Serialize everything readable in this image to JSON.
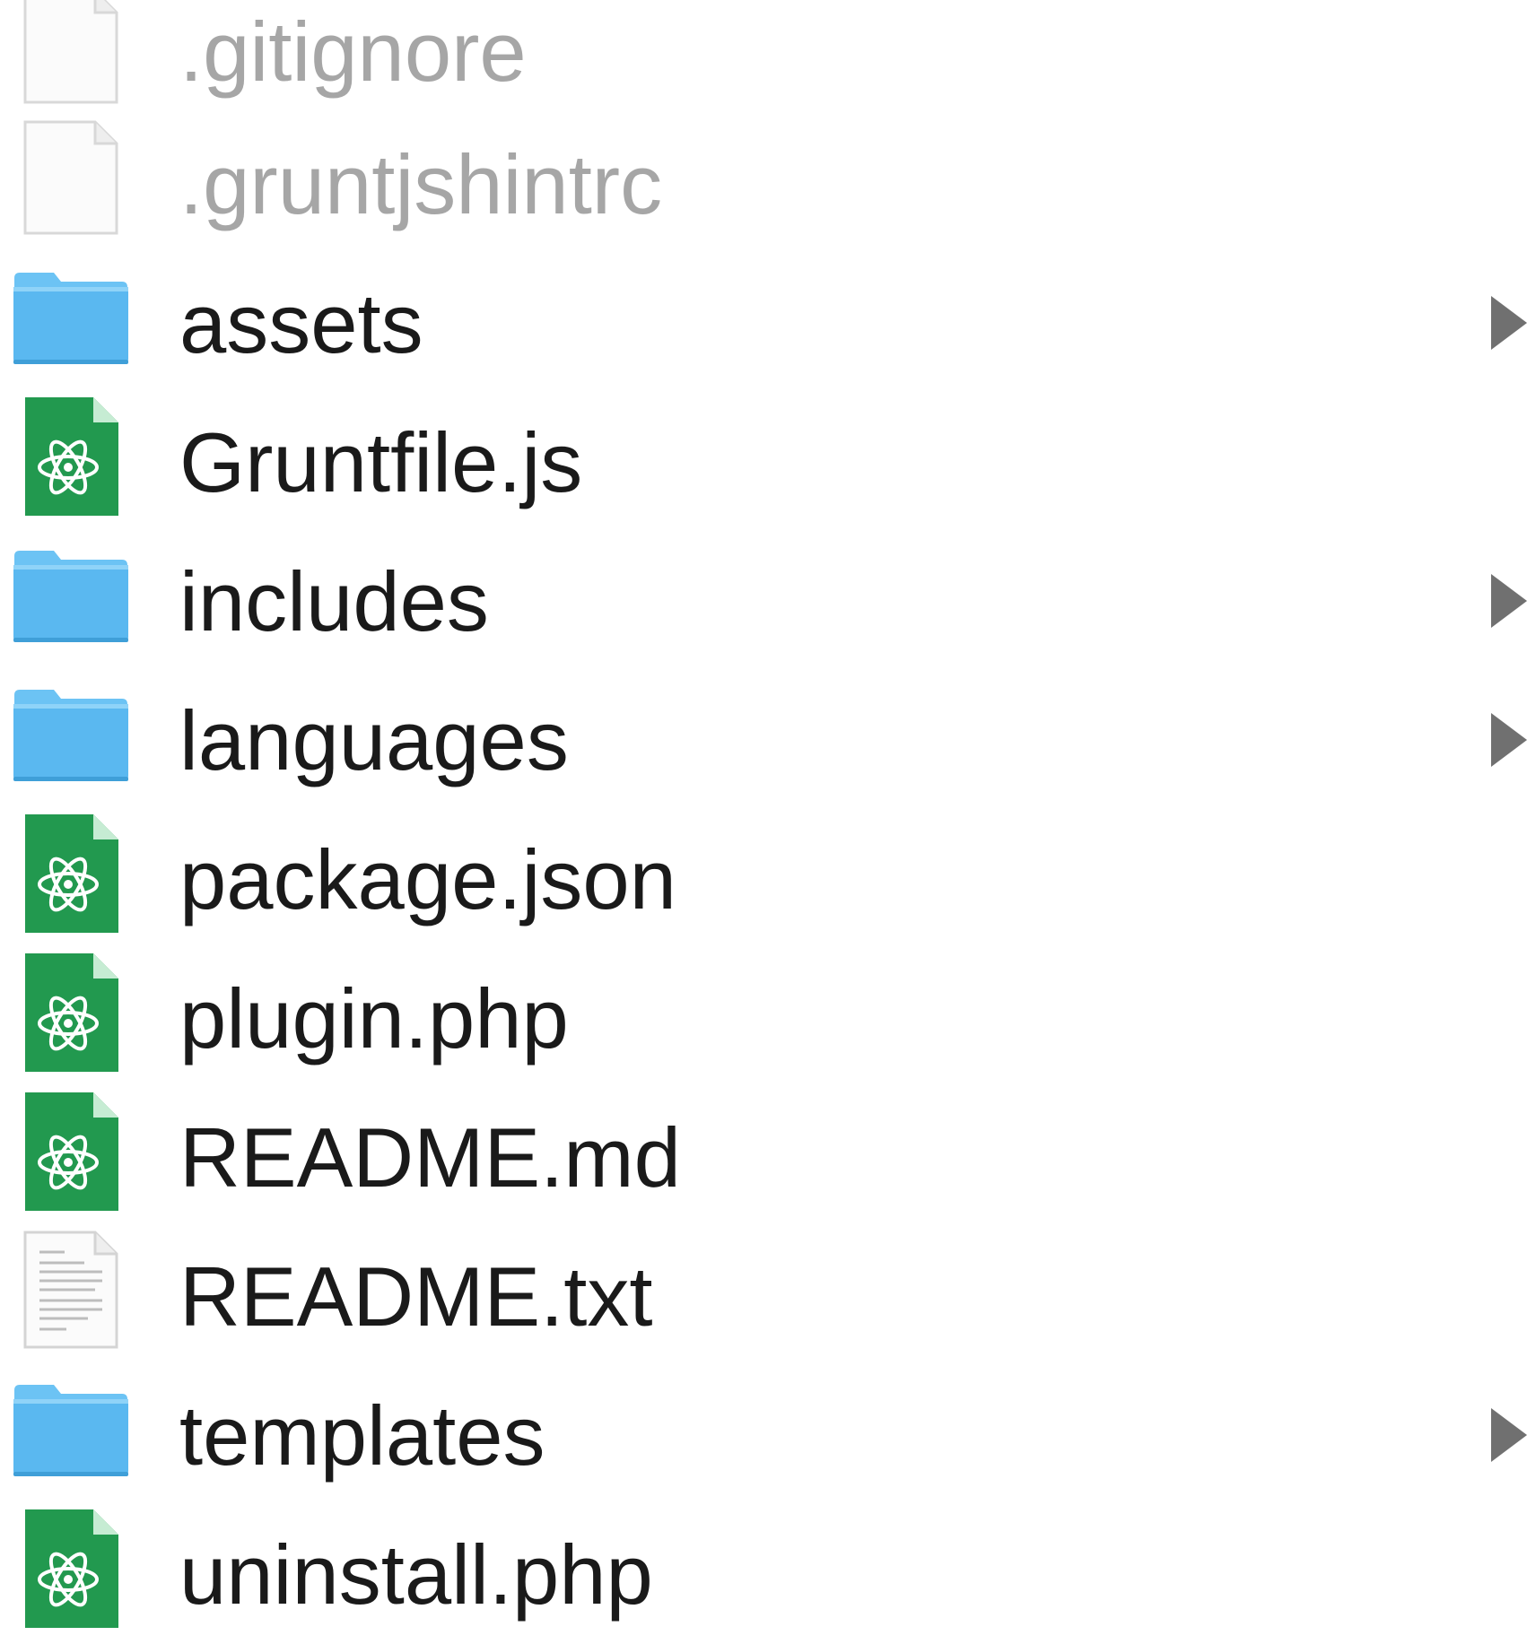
{
  "file_list": {
    "items": [
      {
        "name": ".gitignore",
        "kind": "file",
        "icon": "blank-document-icon",
        "hidden": true
      },
      {
        "name": ".gruntjshintrc",
        "kind": "file",
        "icon": "blank-document-icon",
        "hidden": true
      },
      {
        "name": "assets",
        "kind": "folder",
        "icon": "folder-icon",
        "hidden": false
      },
      {
        "name": "Gruntfile.js",
        "kind": "file",
        "icon": "atom-document-icon",
        "hidden": false
      },
      {
        "name": "includes",
        "kind": "folder",
        "icon": "folder-icon",
        "hidden": false
      },
      {
        "name": "languages",
        "kind": "folder",
        "icon": "folder-icon",
        "hidden": false
      },
      {
        "name": "package.json",
        "kind": "file",
        "icon": "atom-document-icon",
        "hidden": false
      },
      {
        "name": "plugin.php",
        "kind": "file",
        "icon": "atom-document-icon",
        "hidden": false
      },
      {
        "name": "README.md",
        "kind": "file",
        "icon": "atom-document-icon",
        "hidden": false
      },
      {
        "name": "README.txt",
        "kind": "file",
        "icon": "text-document-icon",
        "hidden": false
      },
      {
        "name": "templates",
        "kind": "folder",
        "icon": "folder-icon",
        "hidden": false
      },
      {
        "name": "uninstall.php",
        "kind": "file",
        "icon": "atom-document-icon",
        "hidden": false
      }
    ]
  },
  "colors": {
    "folder_blue": "#5ab8f0",
    "folder_tab_blue": "#6cc3f4",
    "atom_green": "#22994f",
    "hidden_text": "#a6a6a6",
    "text": "#1a1a1a",
    "disclosure_gray": "#707070"
  }
}
